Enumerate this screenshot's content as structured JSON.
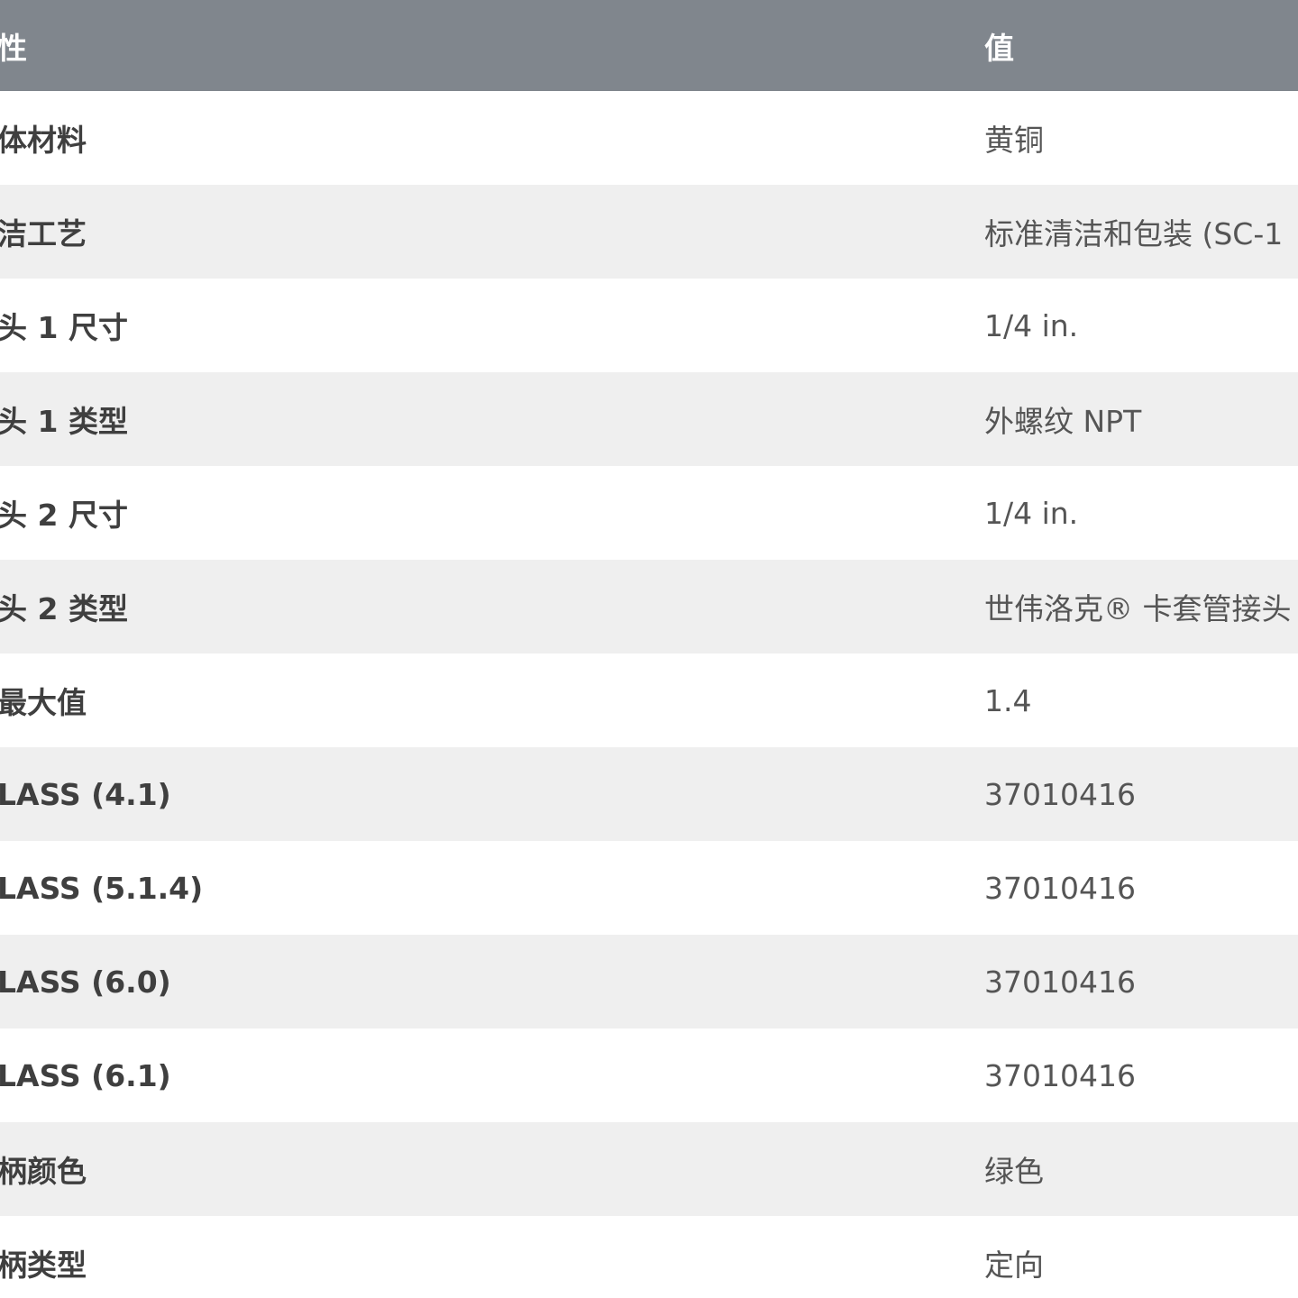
{
  "table": {
    "header": {
      "attribute": "性",
      "value": "值"
    },
    "rows": [
      {
        "attribute": "体材料",
        "value": "黄铜"
      },
      {
        "attribute": "洁工艺",
        "value": "标准清洁和包装 (SC-1"
      },
      {
        "attribute": "头 1 尺寸",
        "value": "1/4 in."
      },
      {
        "attribute": "头 1 类型",
        "value": "外螺纹 NPT"
      },
      {
        "attribute": "头 2 尺寸",
        "value": "1/4 in."
      },
      {
        "attribute": "头 2 类型",
        "value": "世伟洛克® 卡套管接头"
      },
      {
        "attribute": " 最大值",
        "value": "1.4"
      },
      {
        "attribute": "LASS (4.1)",
        "value": "37010416"
      },
      {
        "attribute": "LASS (5.1.4)",
        "value": "37010416"
      },
      {
        "attribute": "LASS (6.0)",
        "value": "37010416"
      },
      {
        "attribute": "LASS (6.1)",
        "value": "37010416"
      },
      {
        "attribute": "柄颜色",
        "value": "绿色"
      },
      {
        "attribute": "柄类型",
        "value": "定向"
      }
    ]
  },
  "colors": {
    "header_background": "#80868d",
    "row_even": "#ffffff",
    "row_odd": "#efefef"
  }
}
